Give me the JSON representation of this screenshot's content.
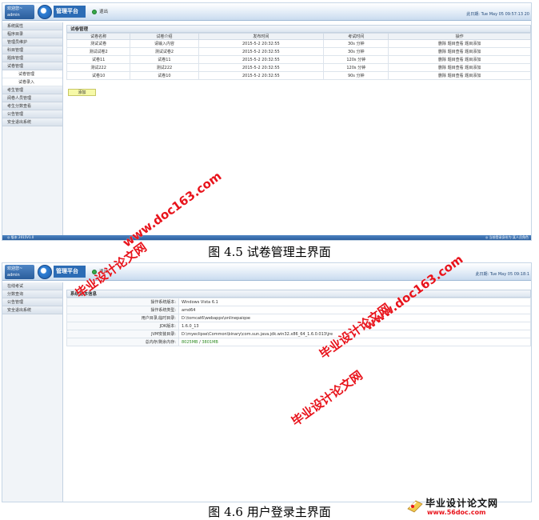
{
  "common": {
    "welcome": "欢迎您~",
    "username": "admin",
    "brand": "管理平台",
    "exit": "退出",
    "datetime1": "此日期: Tue May 05 09:57:13 20",
    "datetime2": "此日期: Tue May 05 09:18:1"
  },
  "shot1": {
    "sidebar": [
      "系统属性",
      "程序目录",
      "管理员维护",
      "科目管理",
      "题库管理",
      "试卷管理"
    ],
    "sub_items": [
      "试卷管理",
      "试卷录入"
    ],
    "sidebar_after": [
      "考生管理",
      "阅卷人员管理",
      "考生分数查看",
      "公告管理",
      "安全退出系统"
    ],
    "panel_title": "试卷管理",
    "columns": [
      "试卷名称",
      "试卷介绍",
      "发布时间",
      "考试时间",
      "操作"
    ],
    "rows": [
      [
        "测试试卷",
        "请输入内容",
        "2015-5-2 20:32:55",
        "30s 分钟",
        "删除 题目查看 题目添加"
      ],
      [
        "测试试卷2",
        "测试试卷2",
        "2015-5-2 20:32:55",
        "30s 分钟",
        "删除 题目查看 题目添加"
      ],
      [
        "试卷11",
        "试卷11",
        "2015-5-2 20:32:55",
        "120s 分钟",
        "删除 题目查看 题目添加"
      ],
      [
        "测试222",
        "测试222",
        "2015-5-2 20:32:55",
        "120s 分钟",
        "删除 题目查看 题目添加"
      ],
      [
        "试卷10",
        "试卷10",
        "2015-5-2 20:32:55",
        "90s 分钟",
        "删除 题目查看 题目添加"
      ]
    ],
    "add_button": "添加",
    "status_left": "◎ 版本 2015V1.0",
    "status_right": "◎ 当前登录身份为:某人员角色"
  },
  "caption1": "图 4.5  试卷管理主界面",
  "shot2": {
    "sidebar": [
      "在线考试",
      "分数查询",
      "公告管理",
      "安全退出系统"
    ],
    "panel_title": "系统基本信息",
    "info": [
      {
        "k": "操作系统版本:",
        "v": "Windows Vista 6.1"
      },
      {
        "k": "操作系统类型:",
        "v": "amd64"
      },
      {
        "k": "用户目录,临时目录:",
        "v": "D:\\tomcat6\\webapps\\onlinepaiqoe"
      },
      {
        "k": "JDK版本:",
        "v": "1.6.0_13"
      },
      {
        "k": "JVM安装目录:",
        "v": "D:\\myeclipse\\Common\\binary\\com.sun.java.jdk.win32.x86_64_1.6.0.013\\jre"
      }
    ],
    "mem_key": "总内存/剩余内存:",
    "mem_used": "8025MB",
    "mem_sep": "/",
    "mem_free": "3801MB"
  },
  "caption2": "图 4.6  用户登录主界面",
  "watermarks": {
    "url": "www.doc163.com",
    "url2": "www.doc163.com",
    "site": "毕业设计论文网",
    "site2": "毕业设计论文网",
    "site3": "毕业设计论文网"
  },
  "bottom_logo": {
    "title": "毕业设计论文网",
    "url": "www.56doc.com"
  },
  "colors": {
    "accent": "#2c6cb5",
    "op_link": "#d41a1a",
    "watermark": "#e8131b"
  }
}
